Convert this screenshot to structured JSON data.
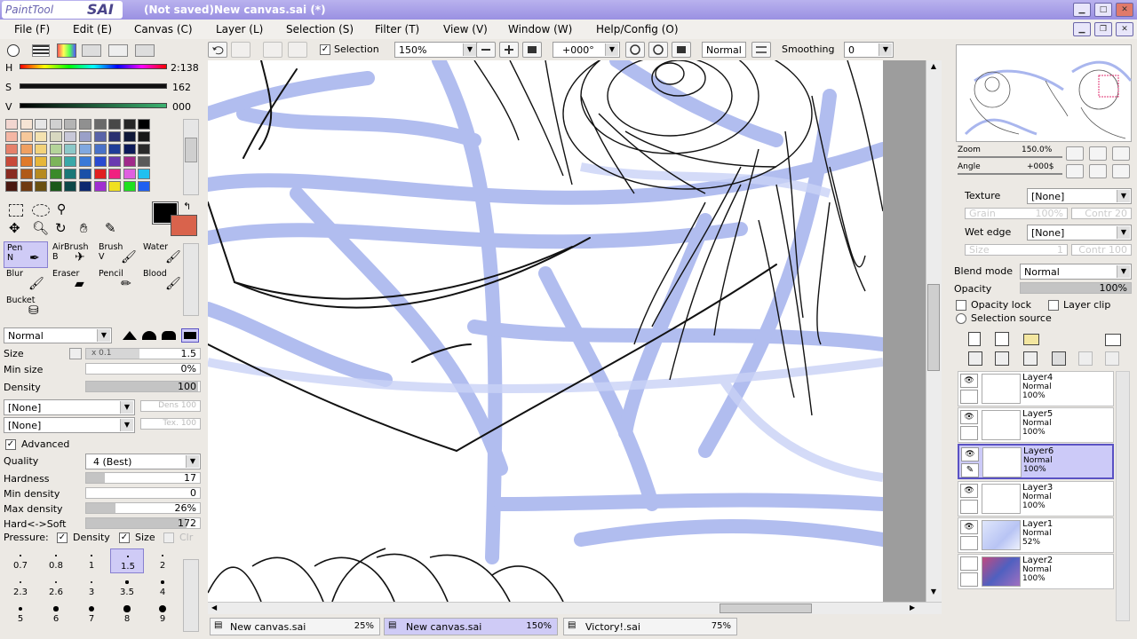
{
  "app": {
    "logo_small": "PaintTool",
    "logo_big": "SAI",
    "title": "(Not saved)New canvas.sai (*)"
  },
  "menu": [
    {
      "label": "File (F)"
    },
    {
      "label": "Edit (E)"
    },
    {
      "label": "Canvas (C)"
    },
    {
      "label": "Layer (L)"
    },
    {
      "label": "Selection (S)"
    },
    {
      "label": "Filter (T)"
    },
    {
      "label": "View (V)"
    },
    {
      "label": "Window (W)"
    },
    {
      "label": "Help/Config (O)"
    }
  ],
  "toolbar": {
    "selection_label": "Selection",
    "zoom": "150%",
    "rotation": "+000°",
    "blend": "Normal",
    "smoothing_label": "Smoothing",
    "smoothing_value": "0"
  },
  "color": {
    "h_label": "H",
    "h_value": "2:138",
    "s_label": "S",
    "s_value": "162",
    "v_label": "V",
    "v_value": "000",
    "primary": "#000000",
    "secondary": "#d9634c"
  },
  "tools": {
    "pen": "Pen",
    "pen_key": "N",
    "airbrush": "AirBrush",
    "airbrush_key": "B",
    "brush": "Brush",
    "brush_key": "V",
    "water": "Water",
    "blur": "Blur",
    "eraser": "Eraser",
    "pencil": "Pencil",
    "blood": "Blood",
    "bucket": "Bucket"
  },
  "props": {
    "mode": "Normal",
    "size_label": "Size",
    "size_mult": "x 0.1",
    "size_value": "1.5",
    "minsize_label": "Min size",
    "minsize_value": "0%",
    "minsize_frac": 0,
    "density_label": "Density",
    "density_value": "100",
    "density_frac": 1,
    "tex1": "[None]",
    "tex1_right": "Dens 100",
    "tex2": "[None]",
    "tex2_right": "Tex. 100",
    "advanced_label": "Advanced",
    "quality_label": "Quality",
    "quality_value": "4 (Best)",
    "hardness_label": "Hardness",
    "hardness_value": "17",
    "hardness_frac": 0.17,
    "mindens_label": "Min density",
    "mindens_value": "0",
    "mindens_frac": 0,
    "maxdens_label": "Max density",
    "maxdens_value": "26%",
    "maxdens_frac": 0.26,
    "hardsoft_label": "Hard<->Soft",
    "hardsoft_value": "172",
    "hardsoft_frac": 0.9,
    "pressure_label": "Pressure:",
    "pressure_density": "Density",
    "pressure_size": "Size",
    "pressure_clr": "Clr"
  },
  "brush_sizes": [
    "0.7",
    "0.8",
    "1",
    "1.5",
    "2",
    "2.3",
    "2.6",
    "3",
    "3.5",
    "4",
    "5",
    "6",
    "7",
    "8",
    "9"
  ],
  "navigator": {
    "zoom_label": "Zoom",
    "zoom_value": "150.0%",
    "angle_label": "Angle",
    "angle_value": "+000$"
  },
  "layerprops": {
    "texture_label": "Texture",
    "texture_value": "[None]",
    "grain_label": "Grain",
    "grain_value": "100%",
    "contr1": "Contr 20",
    "wetedge_label": "Wet edge",
    "wetedge_value": "[None]",
    "wsize_label": "Size",
    "wsize_value": "1",
    "contr2": "Contr 100",
    "blend_label": "Blend mode",
    "blend_value": "Normal",
    "opacity_label": "Opacity",
    "opacity_value": "100%",
    "opacity_lock": "Opacity lock",
    "layer_clip": "Layer clip",
    "selection_source": "Selection source"
  },
  "layers": [
    {
      "name": "Layer4",
      "mode": "Normal",
      "opacity": "100%"
    },
    {
      "name": "Layer5",
      "mode": "Normal",
      "opacity": "100%"
    },
    {
      "name": "Layer6",
      "mode": "Normal",
      "opacity": "100%"
    },
    {
      "name": "Layer3",
      "mode": "Normal",
      "opacity": "100%"
    },
    {
      "name": "Layer1",
      "mode": "Normal",
      "opacity": "52%"
    },
    {
      "name": "Layer2",
      "mode": "Normal",
      "opacity": "100%"
    }
  ],
  "tabs": [
    {
      "name": "New canvas.sai",
      "zoom": "25%"
    },
    {
      "name": "New canvas.sai",
      "zoom": "150%"
    },
    {
      "name": "Victory!.sai",
      "zoom": "75%"
    }
  ],
  "palette": [
    "#f2d6d0",
    "#f6e4d4",
    "#e6e6e6",
    "#d0d0d0",
    "#b4b4b4",
    "#909090",
    "#6a6a6a",
    "#484848",
    "#262626",
    "#000000",
    "#f4b6a4",
    "#f6c89a",
    "#f4e2b0",
    "#d8d8c0",
    "#c8c8d8",
    "#9aa0c8",
    "#5a64a8",
    "#2a3070",
    "#101838",
    "#181818",
    "#e6806a",
    "#f0a060",
    "#f2d27a",
    "#b4d49a",
    "#8cc8c8",
    "#80a8e0",
    "#4a72c8",
    "#1e3c98",
    "#0c1a58",
    "#2a2a2a",
    "#c84a3a",
    "#e07a2a",
    "#e6b63a",
    "#7cb45a",
    "#3aa8a8",
    "#3a7ad8",
    "#2a4ad0",
    "#6a3ab0",
    "#a02a8a",
    "#5a5a5a",
    "#8a2a20",
    "#b05a18",
    "#b68a20",
    "#3a8a2a",
    "#1a7878",
    "#1a50a8",
    "#e02020",
    "#f02080",
    "#e060e0",
    "#20c0f0",
    "#4a1810",
    "#703a10",
    "#6a5010",
    "#1a5818",
    "#0c4848",
    "#0c2870",
    "#a030d0",
    "#f0e020",
    "#20e020",
    "#2060f0"
  ]
}
